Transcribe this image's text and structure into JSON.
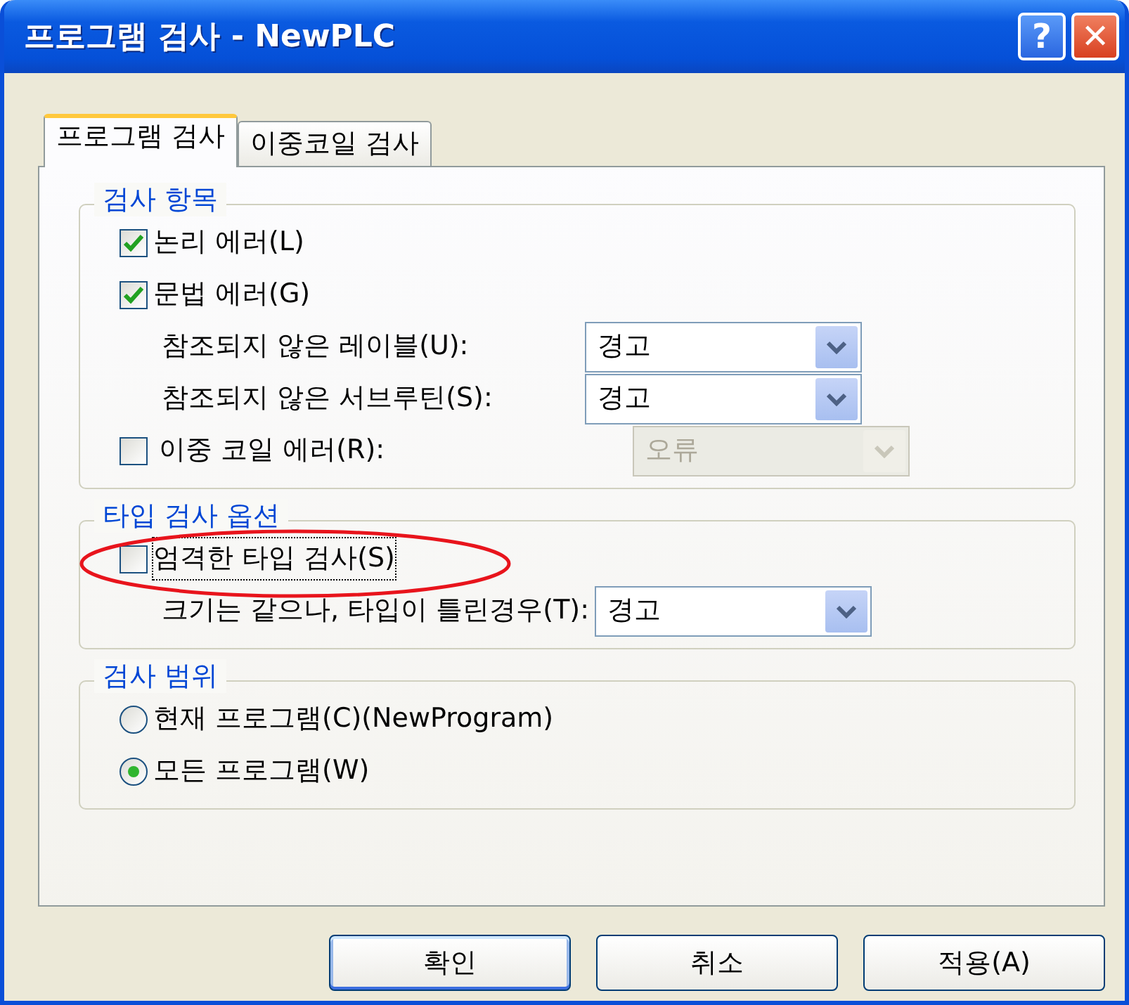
{
  "window": {
    "title": "프로그램 검사 - NewPLC",
    "buttons": [
      {
        "kind": "help",
        "label": "?"
      },
      {
        "kind": "close",
        "label": "✕"
      }
    ]
  },
  "tabs": [
    {
      "label": "프로그램 검사",
      "selected": true
    },
    {
      "label": "이중코일 검사",
      "selected": false
    }
  ],
  "groups": [
    {
      "title": "검사 항목",
      "rows": [
        {
          "kind": "checkbox",
          "label": "논리 에러(L)",
          "checked": true
        },
        {
          "kind": "checkbox",
          "label": "문법 에러(G)",
          "checked": true
        },
        {
          "kind": "combo",
          "label": "참조되지 않은 레이블(U):",
          "value": "경고",
          "disabled": false
        },
        {
          "kind": "combo",
          "label": "참조되지 않은 서브루틴(S):",
          "value": "경고",
          "disabled": false
        },
        {
          "kind": "checkbox_combo",
          "label": "이중 코일 에러(R):",
          "checked": false,
          "value": "오류",
          "disabled": true
        }
      ]
    },
    {
      "title": "타입 검사 옵션",
      "rows": [
        {
          "kind": "checkbox",
          "label": "엄격한 타입 검사(S)",
          "checked": false,
          "focused": true,
          "circled": true
        },
        {
          "kind": "combo",
          "label": "크기는 같으나, 타입이 틀린경우(T):",
          "value": "경고",
          "disabled": false
        }
      ]
    },
    {
      "title": "검사 범위",
      "rows": [
        {
          "kind": "radio",
          "label": "현재 프로그램(C)(NewProgram)",
          "selected": false
        },
        {
          "kind": "radio",
          "label": "모든 프로그램(W)",
          "selected": true
        }
      ]
    }
  ],
  "buttons": [
    {
      "label": "확인",
      "default": true
    },
    {
      "label": "취소",
      "default": false
    },
    {
      "label": "적용(A)",
      "default": false
    }
  ]
}
